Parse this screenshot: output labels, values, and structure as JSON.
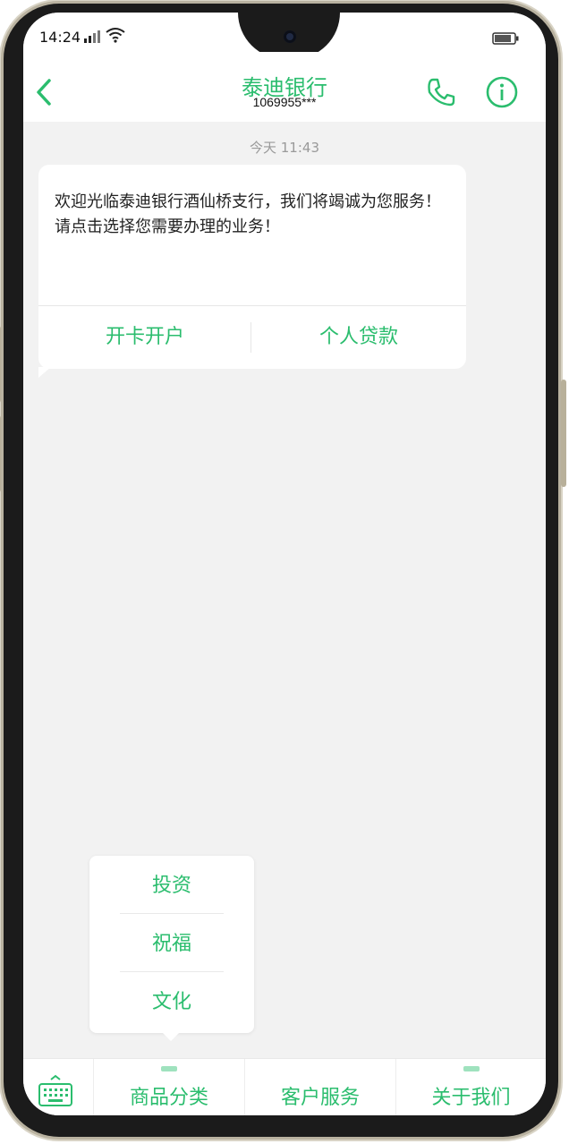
{
  "status_bar": {
    "time": "14:24",
    "icons": [
      "signal-icon",
      "wifi-icon",
      "battery-icon"
    ]
  },
  "header": {
    "title": "泰迪银行",
    "subtitle": "1069955***",
    "icons": [
      "back-icon",
      "phone-icon",
      "info-icon"
    ]
  },
  "chat": {
    "timestamp": "今天 11:43",
    "message": {
      "text": "欢迎光临泰迪银行酒仙桥支行，我们将竭诚为您服务！\n请点击选择您需要办理的业务！",
      "buttons": [
        "开卡开户",
        "个人贷款"
      ]
    }
  },
  "popup_menu": {
    "items": [
      "投资",
      "祝福",
      "文化"
    ]
  },
  "bottom_menu": {
    "keyboard_icon": "keyboard-icon",
    "items": [
      "商品分类",
      "客户服务",
      "关于我们"
    ]
  },
  "colors": {
    "accent": "#2bbd6e",
    "background": "#f2f2f2",
    "bubble": "#ffffff"
  }
}
